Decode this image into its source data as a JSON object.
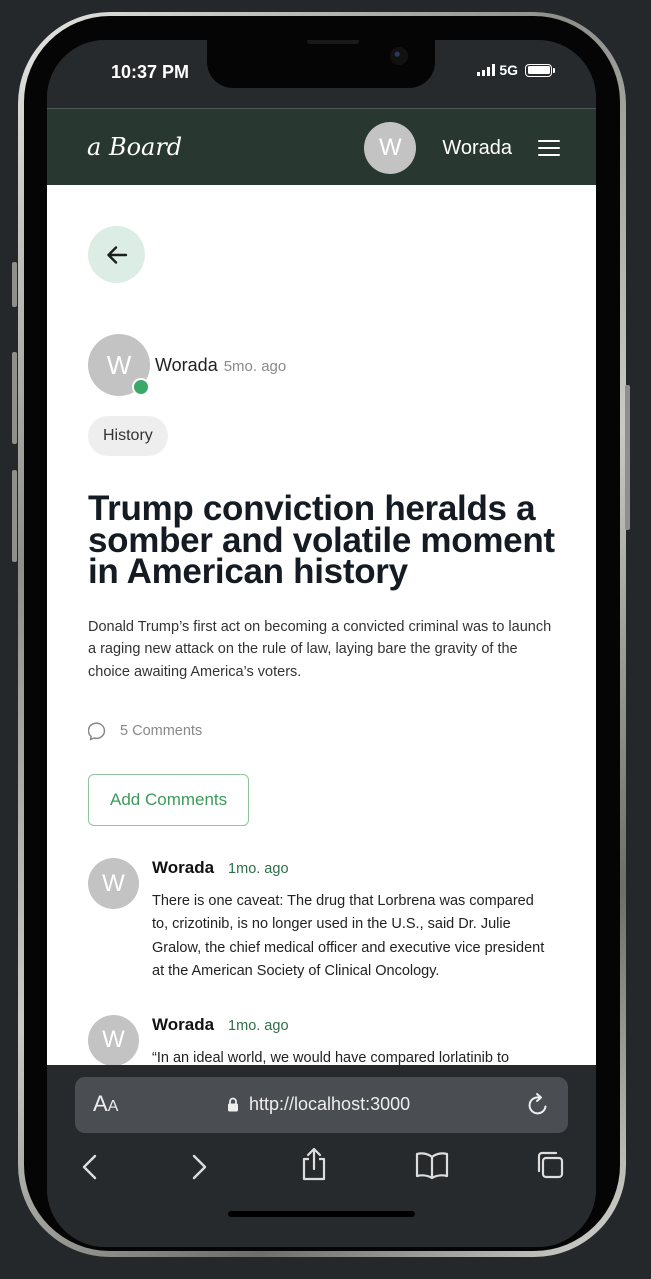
{
  "status_bar": {
    "time": "10:37 PM",
    "network": "5G"
  },
  "header": {
    "logo": "a Board",
    "avatar_initial": "W",
    "username": "Worada"
  },
  "post": {
    "author_initial": "W",
    "author": "Worada",
    "time": "5mo. ago",
    "category": "History",
    "title": "Trump conviction heralds a somber and volatile moment in American history",
    "excerpt": "Donald Trump’s first act on becoming a convicted criminal was to launch a raging new attack on the rule of law, laying bare the gravity of the choice awaiting America’s voters.",
    "comments_count": "5 Comments",
    "add_comment_label": "Add Comments"
  },
  "comments": [
    {
      "initial": "W",
      "author": "Worada",
      "time": "1mo. ago",
      "text": "There is one caveat: The drug that Lorbrena was compared to, crizotinib, is no longer used in the U.S., said Dr. Julie Gralow, the chief medical officer and executive vice president at the American Society of Clinical Oncology."
    },
    {
      "initial": "W",
      "author": "Worada",
      "time": "1mo. ago",
      "text": "“In an ideal world, we would have compared lorlatinib to"
    }
  ],
  "browser": {
    "text_size_label_big": "A",
    "text_size_label_small": "A",
    "url": "http://localhost:3000"
  },
  "colors": {
    "header_bg": "#283830",
    "accent_green": "#3d9a5b",
    "online_dot": "#3ba867",
    "back_button_bg": "#dcede6"
  }
}
